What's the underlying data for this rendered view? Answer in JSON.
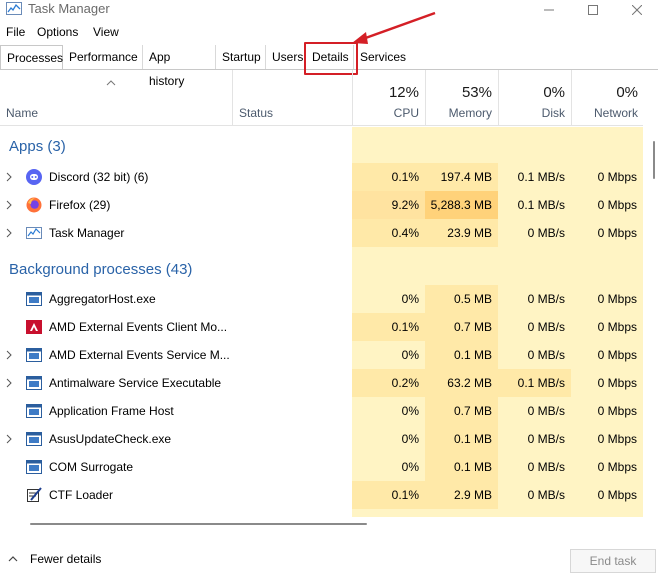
{
  "window": {
    "title": "Task Manager",
    "controls": [
      "minimize-icon",
      "maximize-icon",
      "close-icon"
    ]
  },
  "menu": [
    "File",
    "Options",
    "View"
  ],
  "tabs": [
    {
      "label": "Processes",
      "active": true
    },
    {
      "label": "Performance",
      "active": false
    },
    {
      "label": "App history",
      "active": false
    },
    {
      "label": "Startup",
      "active": false
    },
    {
      "label": "Users",
      "active": false
    },
    {
      "label": "Details",
      "active": false,
      "highlighted": true
    },
    {
      "label": "Services",
      "active": false
    }
  ],
  "annotation": {
    "color": "#d41f26"
  },
  "columns": {
    "name": "Name",
    "status": "Status",
    "cpu": {
      "pct": "12%",
      "label": "CPU"
    },
    "memory": {
      "pct": "53%",
      "label": "Memory"
    },
    "disk": {
      "pct": "0%",
      "label": "Disk"
    },
    "network": {
      "pct": "0%",
      "label": "Network"
    }
  },
  "groups": {
    "apps": "Apps (3)",
    "background": "Background processes (43)"
  },
  "apps": [
    {
      "name": "Discord (32 bit) (6)",
      "icon": "discord-icon",
      "expandable": true,
      "cpu": "0.1%",
      "memory": "197.4 MB",
      "disk": "0.1 MB/s",
      "network": "0 Mbps"
    },
    {
      "name": "Firefox (29)",
      "icon": "firefox-icon",
      "expandable": true,
      "cpu": "9.2%",
      "memory": "5,288.3 MB",
      "disk": "0.1 MB/s",
      "network": "0 Mbps"
    },
    {
      "name": "Task Manager",
      "icon": "task-manager-icon",
      "expandable": true,
      "cpu": "0.4%",
      "memory": "23.9 MB",
      "disk": "0 MB/s",
      "network": "0 Mbps"
    }
  ],
  "background": [
    {
      "name": "AggregatorHost.exe",
      "icon": "process-icon",
      "expandable": false,
      "cpu": "0%",
      "memory": "0.5 MB",
      "disk": "0 MB/s",
      "network": "0 Mbps"
    },
    {
      "name": "AMD External Events Client Mo...",
      "icon": "amd-icon",
      "expandable": false,
      "cpu": "0.1%",
      "memory": "0.7 MB",
      "disk": "0 MB/s",
      "network": "0 Mbps"
    },
    {
      "name": "AMD External Events Service M...",
      "icon": "process-icon",
      "expandable": true,
      "cpu": "0%",
      "memory": "0.1 MB",
      "disk": "0 MB/s",
      "network": "0 Mbps"
    },
    {
      "name": "Antimalware Service Executable",
      "icon": "process-icon",
      "expandable": true,
      "cpu": "0.2%",
      "memory": "63.2 MB",
      "disk": "0.1 MB/s",
      "network": "0 Mbps"
    },
    {
      "name": "Application Frame Host",
      "icon": "process-icon",
      "expandable": false,
      "cpu": "0%",
      "memory": "0.7 MB",
      "disk": "0 MB/s",
      "network": "0 Mbps"
    },
    {
      "name": "AsusUpdateCheck.exe",
      "icon": "process-icon",
      "expandable": true,
      "cpu": "0%",
      "memory": "0.1 MB",
      "disk": "0 MB/s",
      "network": "0 Mbps"
    },
    {
      "name": "COM Surrogate",
      "icon": "process-icon",
      "expandable": false,
      "cpu": "0%",
      "memory": "0.1 MB",
      "disk": "0 MB/s",
      "network": "0 Mbps"
    },
    {
      "name": "CTF Loader",
      "icon": "ctf-loader-icon",
      "expandable": false,
      "cpu": "0.1%",
      "memory": "2.9 MB",
      "disk": "0 MB/s",
      "network": "0 Mbps"
    }
  ],
  "colors": {
    "heat_light": "#fff4c4",
    "heat_mid": "#ffe9a8",
    "heat_strong": "#ffd27a",
    "group_title": "#2a63a8"
  },
  "footer": {
    "fewer_details": "Fewer details",
    "end_task": "End task"
  }
}
